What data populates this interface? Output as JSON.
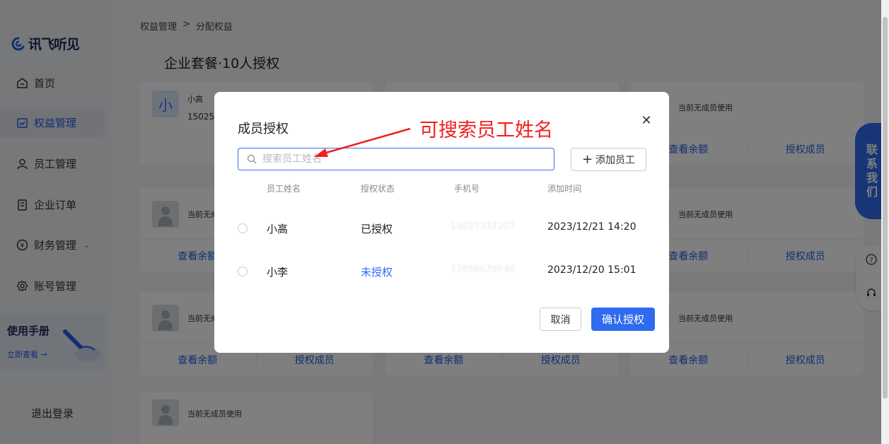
{
  "app": {
    "logo_text": "讯飞听见"
  },
  "sidebar": {
    "items": [
      {
        "label": "首页",
        "icon": "home-icon"
      },
      {
        "label": "权益管理",
        "icon": "rights-icon",
        "active": true
      },
      {
        "label": "员工管理",
        "icon": "user-icon"
      },
      {
        "label": "企业订单",
        "icon": "order-icon"
      },
      {
        "label": "财务管理",
        "icon": "finance-icon",
        "has_dropdown": true
      },
      {
        "label": "账号管理",
        "icon": "gear-icon"
      }
    ],
    "manual": {
      "title": "使用手册",
      "link": "立即查看 →"
    },
    "logout": "退出登录"
  },
  "breadcrumb": {
    "parent": "权益管理",
    "separator": ">",
    "current": "分配权益"
  },
  "page_title": "企业套餐·10人授权",
  "cards": {
    "first": {
      "avatar_char": "小",
      "name": "小高",
      "phone_partial": "15025"
    },
    "empty_text": "当前无成员使用",
    "check_balance": "查看余额",
    "authorize_members": "授权成员"
  },
  "contact": {
    "label": [
      "联",
      "系",
      "我",
      "们"
    ]
  },
  "modal": {
    "title": "成员授权",
    "annotation": "可搜索员工姓名",
    "search_placeholder": "搜索员工姓名",
    "add_employee": "添加员工",
    "columns": [
      "员工姓名",
      "授权状态",
      "手机号",
      "添加时间"
    ],
    "rows": [
      {
        "name": "小高",
        "status": "已授权",
        "phone": "15025337207",
        "time": "2023/12/21 14:20"
      },
      {
        "name": "小李",
        "status": "未授权",
        "phone": "17856670530",
        "time": "2023/12/20 15:01"
      }
    ],
    "cancel": "取消",
    "confirm": "确认授权"
  },
  "colors": {
    "accent": "#2e6bef",
    "annotation": "#f02020"
  }
}
